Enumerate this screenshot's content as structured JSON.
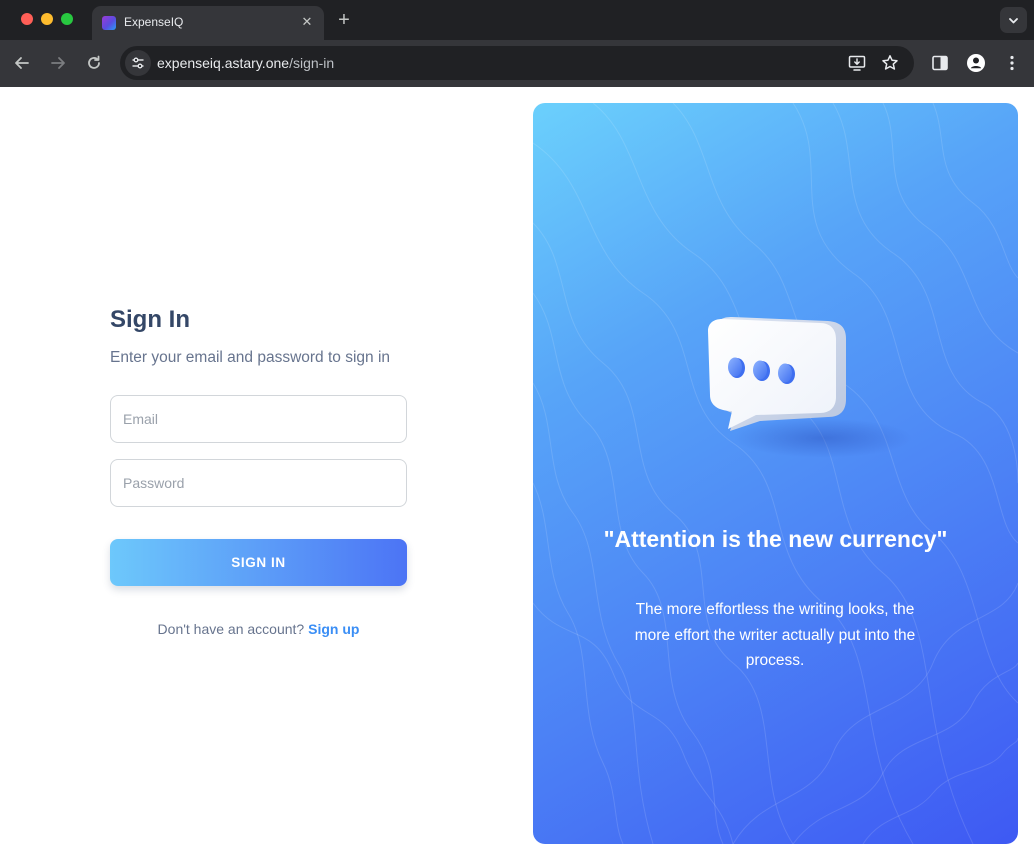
{
  "browser": {
    "tab_title": "ExpenseIQ",
    "url_host": "expenseiq.astary.one",
    "url_path": "/sign-in"
  },
  "icons": {
    "back": "arrow-left-icon",
    "forward": "arrow-right-icon",
    "reload": "reload-icon",
    "site_info": "tune-icon",
    "install": "install-app-icon",
    "bookmark": "star-icon",
    "side_panel": "side-panel-icon",
    "profile": "profile-icon",
    "menu": "kebab-menu-icon"
  },
  "signin": {
    "title": "Sign In",
    "subtitle": "Enter your email and password to sign in",
    "email_placeholder": "Email",
    "password_placeholder": "Password",
    "button_label": "SIGN IN",
    "no_account_text": "Don't have an account?",
    "signup_link": "Sign up"
  },
  "promo": {
    "quote": "\"Attention is the new currency\"",
    "description": "The more effortless the writing looks, the more effort the writer actually put into the process."
  },
  "colors": {
    "title_text": "#344767",
    "body_text": "#67748e",
    "link": "#3a8ef5",
    "gradient_start": "#6dc8fb",
    "gradient_end": "#3e59f3"
  }
}
